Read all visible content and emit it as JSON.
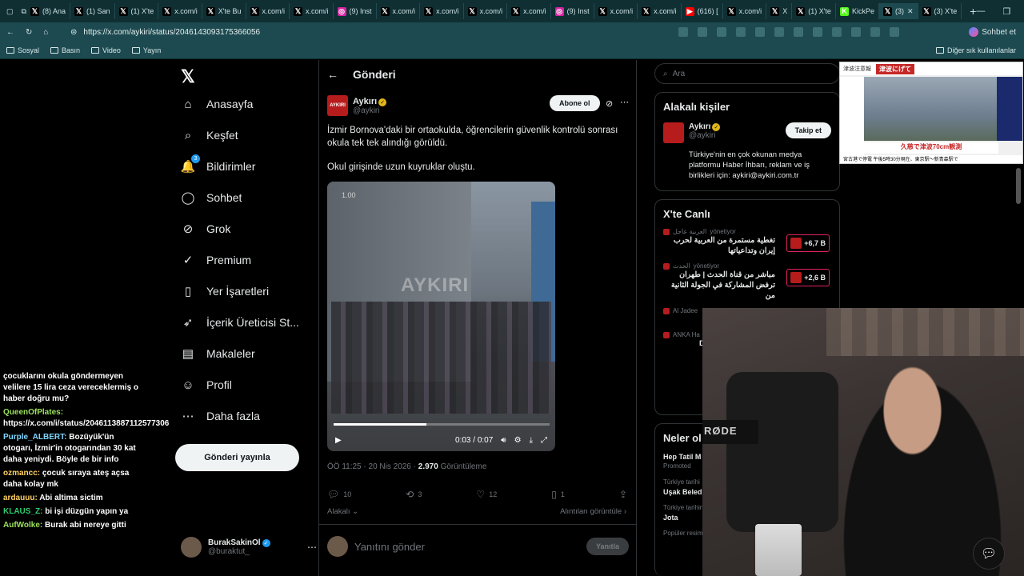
{
  "browser": {
    "tabs": [
      {
        "label": "(8) Ana",
        "icon": "x"
      },
      {
        "label": "(1) San",
        "icon": "x"
      },
      {
        "label": "(1) X'te",
        "icon": "x"
      },
      {
        "label": "x.com/i",
        "icon": "x"
      },
      {
        "label": "X'te Bu",
        "icon": "x"
      },
      {
        "label": "x.com/i",
        "icon": "x"
      },
      {
        "label": "x.com/i",
        "icon": "x"
      },
      {
        "label": "(9) Inst",
        "icon": "instagram"
      },
      {
        "label": "x.com/i",
        "icon": "x"
      },
      {
        "label": "x.com/i",
        "icon": "x"
      },
      {
        "label": "x.com/i",
        "icon": "x"
      },
      {
        "label": "x.com/i",
        "icon": "x"
      },
      {
        "label": "(9) Inst",
        "icon": "instagram"
      },
      {
        "label": "x.com/i",
        "icon": "x"
      },
      {
        "label": "x.com/i",
        "icon": "x"
      },
      {
        "label": "(616) [",
        "icon": "youtube"
      },
      {
        "label": "x.com/i",
        "icon": "x"
      },
      {
        "label": "X",
        "icon": "x"
      },
      {
        "label": "(1) X'te",
        "icon": "x"
      },
      {
        "label": "KickPe",
        "icon": "kick"
      },
      {
        "label": "(3)",
        "icon": "x",
        "active": true
      },
      {
        "label": "(3) X'te",
        "icon": "x"
      }
    ],
    "url": "https://x.com/aykiri/status/2046143093175366056",
    "chat_button": "Sohbet et",
    "bookmarks": [
      "Sosyal",
      "Basın",
      "Video",
      "Yayın"
    ],
    "other_bookmarks": "Diğer sık kullanılanlar"
  },
  "nav": {
    "items": [
      {
        "label": "Anasayfa",
        "icon": "home-icon",
        "glyph": "⌂"
      },
      {
        "label": "Keşfet",
        "icon": "search-icon",
        "glyph": "⌕"
      },
      {
        "label": "Bildirimler",
        "icon": "bell-icon",
        "glyph": "🔔",
        "badge": "3"
      },
      {
        "label": "Sohbet",
        "icon": "chat-icon",
        "glyph": "◯"
      },
      {
        "label": "Grok",
        "icon": "grok-icon",
        "glyph": "⊘"
      },
      {
        "label": "Premium",
        "icon": "premium-icon",
        "glyph": "✓"
      },
      {
        "label": "Yer İşaretleri",
        "icon": "bookmark-icon",
        "glyph": "▯"
      },
      {
        "label": "İçerik Üreticisi St...",
        "icon": "rocket-icon",
        "glyph": "➶"
      },
      {
        "label": "Makaleler",
        "icon": "article-icon",
        "glyph": "▤"
      },
      {
        "label": "Profil",
        "icon": "profile-icon",
        "glyph": "☺"
      },
      {
        "label": "Daha fazla",
        "icon": "more-icon",
        "glyph": "⋯"
      }
    ],
    "post_button": "Gönderi yayınla",
    "user": {
      "name": "BurakSakinOl",
      "handle": "@buraktut_"
    }
  },
  "post": {
    "header": "Gönderi",
    "author": {
      "name": "Aykırı",
      "handle": "@aykiri",
      "avatar_text": "AYKIRI"
    },
    "subscribe": "Abone ol",
    "text": "İzmir Bornova'daki bir ortaokulda, öğrencilerin güvenlik kontrolü sonrası okula tek tek alındığı görüldü.",
    "text2": "Okul girişinde uzun kuyruklar oluştu.",
    "video": {
      "watermark": "AYKIRI",
      "speed": "1.00",
      "time": "0:03 / 0:07",
      "progress": 0.43
    },
    "meta": {
      "prefix": "ÖÖ 11:25 · 20 Nis 2026 · ",
      "views": "2.970",
      "views_label": " Görüntüleme"
    },
    "actions": {
      "replies": "10",
      "reposts": "3",
      "likes": "12",
      "bookmarks": "1"
    },
    "related": "Alakalı",
    "quotes": "Alıntıları görüntüle",
    "reply_placeholder": "Yanıtını gönder",
    "reply_button": "Yanıtla"
  },
  "right": {
    "search_placeholder": "Ara",
    "related_title": "Alakalı kişiler",
    "related_person": {
      "name": "Aykırı",
      "handle": "@aykiri",
      "bio": "Türkiye'nin en çok okunan medya platformu Haber İhbarı, reklam ve iş birlikleri için: aykiri@aykiri.com.tr",
      "follow": "Takip et"
    },
    "live_title": "X'te Canlı",
    "live": [
      {
        "source": "العربية عاجل",
        "role": "yönetiyor",
        "title": "تغطية مستمرة من العربية لحرب إيران وتداعياتها",
        "count": "+6,7 B"
      },
      {
        "source": "الحدث",
        "role": "yönetiyor",
        "title": "مباشر من قناة الحدث | طهران ترفض المشاركة في الجولة الثانية من",
        "count": "+2,6 B"
      },
      {
        "source": "Al Jadee",
        "role": "",
        "title": "دة من برنامج الحدث\"\"",
        "count": ""
      },
      {
        "source": "ANKA Ha",
        "role": "",
        "title": "DEM Parti Gülistan K",
        "count": ""
      }
    ],
    "whats_title": "Neler ol",
    "trends": [
      {
        "small": "",
        "title": "Hep Tatil M",
        "sub": "Promoted"
      },
      {
        "small": "Türkiye tarihi",
        "title": "Uşak Beled",
        "sub": ""
      },
      {
        "small": "Türkiye tarihinde gündemde",
        "title": "Jota",
        "sub": ""
      },
      {
        "small": "Popüler resimler · Gündemde",
        "title": "",
        "sub": ""
      }
    ]
  },
  "overlay_news": {
    "header": "津波注意報",
    "red_tag": "津波にげて",
    "caption": "久慈で津波70cm観測",
    "ticker": "宮古港で停電 午後5時30分現在、東京駅〜新青森駅で"
  },
  "stream_chat": [
    {
      "user": "",
      "text": "çocuklarını okula göndermeyen velilere 15 lira ceza vereceklermiş o haber doğru mu?"
    },
    {
      "user": "QueenOfPlates:",
      "text": "https://x.com/i/status/2046113887112577306"
    },
    {
      "user": "Purple_ALBERT:",
      "text": "Bozüyük'ün otogarı, İzmir'in otogarından 30 kat daha yeniydi. Böyle de bir info"
    },
    {
      "user": "ozmancc:",
      "text": "çocuk sıraya ateş açsa daha kolay mk"
    },
    {
      "user": "ardauuu:",
      "text": "Abi altima sictim"
    },
    {
      "user": "KLAUS_Z:",
      "text": "bi işi düzgün yapın ya"
    },
    {
      "user": "AufWolke:",
      "text": "Burak abi nereye gitti"
    }
  ],
  "webcam": {
    "mic_brand": "RØDE"
  },
  "colors": {
    "accent": "#1d9bf0",
    "background": "#000000",
    "browser_chrome": "#1d4a50",
    "verified": "#e2b719"
  }
}
